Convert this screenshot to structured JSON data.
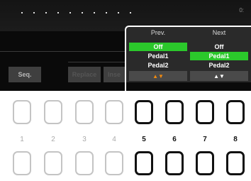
{
  "screen": {
    "corner_text": "0:",
    "buttons": [
      {
        "label": "Seq."
      },
      {
        "label": "Replace"
      },
      {
        "label": "Inse"
      }
    ]
  },
  "pedal_panel": {
    "columns": [
      {
        "header": "Prev.",
        "options": [
          "Off",
          "Pedal1",
          "Pedal2"
        ],
        "selected": "Off",
        "arrows": "▲▼"
      },
      {
        "header": "Next",
        "options": [
          "Off",
          "Pedal1",
          "Pedal2"
        ],
        "selected": "Pedal1",
        "arrows": "▲▼"
      }
    ],
    "colors": {
      "selected": "#2bc82b",
      "prev_arrows": "#f08a10",
      "next_arrows": "#ffffff"
    }
  },
  "hardware_buttons": {
    "numbers": [
      "1",
      "2",
      "3",
      "4",
      "5",
      "6",
      "7",
      "8"
    ],
    "active": [
      "5",
      "6",
      "7",
      "8"
    ]
  }
}
